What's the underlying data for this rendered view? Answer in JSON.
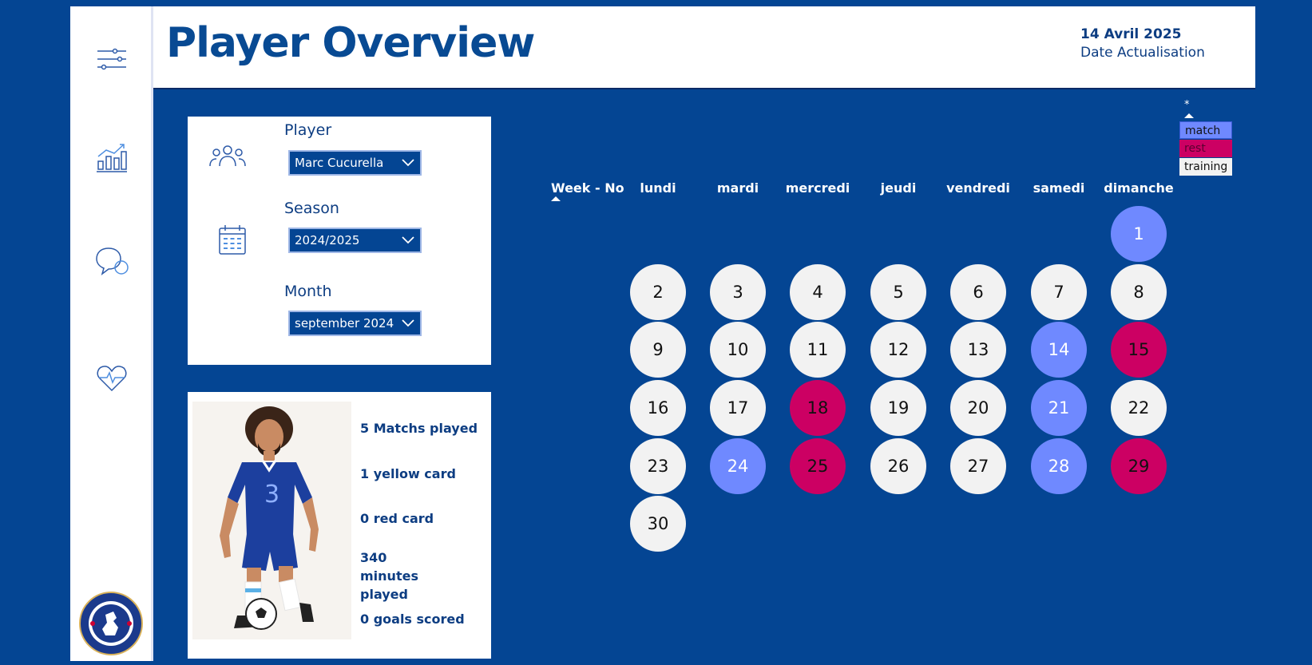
{
  "header": {
    "title": "Player Overview",
    "date_value": "14 Avril 2025",
    "date_label": "Date Actualisation"
  },
  "sidebar": {
    "items": [
      {
        "icon": "sliders-icon"
      },
      {
        "icon": "chart-icon"
      },
      {
        "icon": "chat-icon"
      },
      {
        "icon": "heart-pulse-icon"
      }
    ],
    "crest_icon": "chelsea-crest-icon"
  },
  "filters": {
    "player": {
      "label": "Player",
      "value": "Marc Cucurella"
    },
    "season": {
      "label": "Season",
      "value": "2024/2025"
    },
    "month": {
      "label": "Month",
      "value": "september 2024"
    }
  },
  "stats": {
    "matches": "5 Matchs played",
    "yellow": "1 yellow card",
    "red": "0 red card",
    "minutes": "340 minutes played",
    "goals": "0 goals scored"
  },
  "calendar": {
    "week_header": "Week - No",
    "days": [
      "lundi",
      "mardi",
      "mercredi",
      "jeudi",
      "vendredi",
      "samedi",
      "dimanche"
    ],
    "dates": [
      {
        "n": "1",
        "status": "match"
      },
      {
        "n": "2",
        "status": "training"
      },
      {
        "n": "3",
        "status": "training"
      },
      {
        "n": "4",
        "status": "training"
      },
      {
        "n": "5",
        "status": "training"
      },
      {
        "n": "6",
        "status": "training"
      },
      {
        "n": "7",
        "status": "training"
      },
      {
        "n": "8",
        "status": "training"
      },
      {
        "n": "9",
        "status": "training"
      },
      {
        "n": "10",
        "status": "training"
      },
      {
        "n": "11",
        "status": "training"
      },
      {
        "n": "12",
        "status": "training"
      },
      {
        "n": "13",
        "status": "training"
      },
      {
        "n": "14",
        "status": "match"
      },
      {
        "n": "15",
        "status": "rest"
      },
      {
        "n": "16",
        "status": "training"
      },
      {
        "n": "17",
        "status": "training"
      },
      {
        "n": "18",
        "status": "rest"
      },
      {
        "n": "19",
        "status": "training"
      },
      {
        "n": "20",
        "status": "training"
      },
      {
        "n": "21",
        "status": "match"
      },
      {
        "n": "22",
        "status": "training"
      },
      {
        "n": "23",
        "status": "training"
      },
      {
        "n": "24",
        "status": "match"
      },
      {
        "n": "25",
        "status": "rest"
      },
      {
        "n": "26",
        "status": "training"
      },
      {
        "n": "27",
        "status": "training"
      },
      {
        "n": "28",
        "status": "match"
      },
      {
        "n": "29",
        "status": "rest"
      },
      {
        "n": "30",
        "status": "training"
      }
    ]
  },
  "legend": {
    "marker": "*",
    "items": [
      {
        "label": "match",
        "color": "#6f89ff"
      },
      {
        "label": "rest",
        "color": "#cc0063"
      },
      {
        "label": "training",
        "color": "#f2f2f2"
      }
    ]
  },
  "colors": {
    "background": "#044593",
    "match": "#6f89ff",
    "rest": "#cc0063",
    "training": "#f2f2f2",
    "title": "#084a93"
  }
}
